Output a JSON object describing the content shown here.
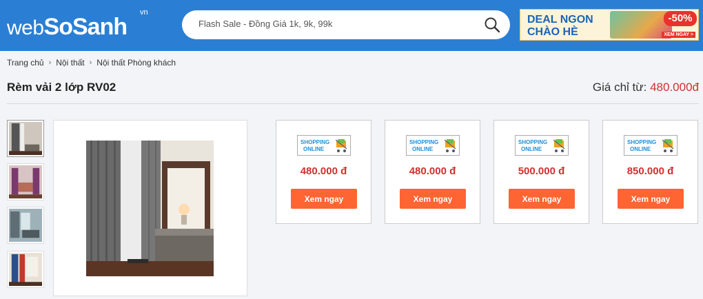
{
  "header": {
    "logo": {
      "part1": "web",
      "part2": "SoSanh",
      "tld": "vn"
    },
    "search": {
      "placeholder": "Flash Sale - Đồng Giá 1k, 9k, 99k"
    },
    "banner": {
      "line1": "DEAL NGON",
      "line2": "CHÀO HÈ",
      "discount": "-50%",
      "cta": "XEM NGAY >"
    }
  },
  "breadcrumb": [
    "Trang chủ",
    "Nội thất",
    "Nội thất Phòng khách"
  ],
  "product": {
    "title": "Rèm vải 2 lớp RV02",
    "price_prefix": "Giá chỉ từ:",
    "price": "480.000đ"
  },
  "thumbnails": [
    {
      "name": "thumbnail-1",
      "active": true
    },
    {
      "name": "thumbnail-2",
      "active": false
    },
    {
      "name": "thumbnail-3",
      "active": false
    },
    {
      "name": "thumbnail-4",
      "active": false
    }
  ],
  "offers": [
    {
      "shop_line1": "SHOPPING",
      "shop_line2": "ONLINE",
      "price": "480.000 đ",
      "button": "Xem ngay"
    },
    {
      "shop_line1": "SHOPPING",
      "shop_line2": "ONLINE",
      "price": "480.000 đ",
      "button": "Xem ngay"
    },
    {
      "shop_line1": "SHOPPING",
      "shop_line2": "ONLINE",
      "price": "500.000 đ",
      "button": "Xem ngay"
    },
    {
      "shop_line1": "SHOPPING",
      "shop_line2": "ONLINE",
      "price": "850.000 đ",
      "button": "Xem ngay"
    }
  ],
  "colors": {
    "header_bg": "#2a7fd4",
    "price_red": "#d32f2f",
    "button_orange": "#ff6433"
  }
}
